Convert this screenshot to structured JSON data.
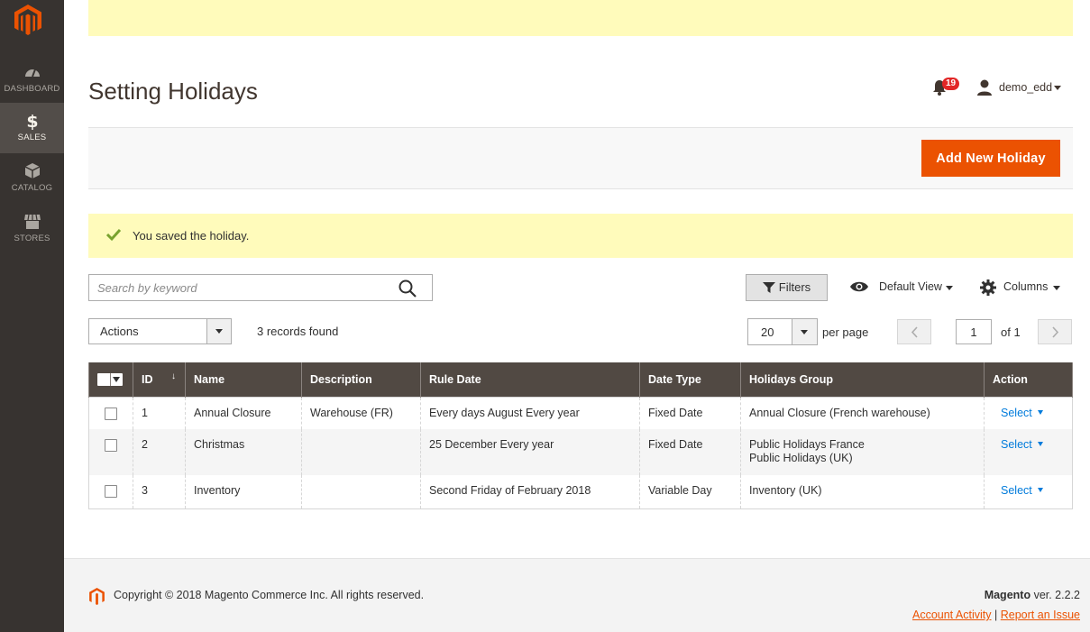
{
  "sidebar": {
    "items": [
      {
        "label": "DASHBOARD",
        "icon": "dashboard-icon",
        "active": false
      },
      {
        "label": "SALES",
        "icon": "dollar-icon",
        "active": true
      },
      {
        "label": "CATALOG",
        "icon": "box-icon",
        "active": false
      },
      {
        "label": "STORES",
        "icon": "store-icon",
        "active": false
      }
    ]
  },
  "header": {
    "title": "Setting Holidays",
    "notifications_count": "19",
    "user_name": "demo_edd"
  },
  "toolbar": {
    "add_button_label": "Add New Holiday"
  },
  "message": {
    "text": "You saved the holiday."
  },
  "grid_controls": {
    "search_placeholder": "Search by keyword",
    "filters_label": "Filters",
    "view_label": "Default View",
    "columns_label": "Columns",
    "actions_label": "Actions",
    "records_found": "3 records found",
    "per_page_value": "20",
    "per_page_label": "per page",
    "current_page": "1",
    "page_of": "of 1"
  },
  "grid": {
    "columns": [
      "ID",
      "Name",
      "Description",
      "Rule Date",
      "Date Type",
      "Holidays Group",
      "Action"
    ],
    "rows": [
      {
        "id": "1",
        "name": "Annual Closure",
        "description": "Warehouse (FR)",
        "rule_date": "Every days August Every year",
        "date_type": "Fixed Date",
        "group_1": "Annual Closure (French warehouse)",
        "group_2": "",
        "action": "Select"
      },
      {
        "id": "2",
        "name": "Christmas",
        "description": "",
        "rule_date": "25 December Every year",
        "date_type": "Fixed Date",
        "group_1": "Public Holidays France",
        "group_2": "Public Holidays (UK)",
        "action": "Select"
      },
      {
        "id": "3",
        "name": "Inventory",
        "description": "",
        "rule_date": "Second Friday of February 2018",
        "date_type": "Variable Day",
        "group_1": "Inventory (UK)",
        "group_2": "",
        "action": "Select"
      }
    ]
  },
  "footer": {
    "copyright": "Copyright © 2018 Magento Commerce Inc. All rights reserved.",
    "brand": "Magento",
    "version": "ver. 2.2.2",
    "link_activity": "Account Activity",
    "separator": "|",
    "link_issue": "Report an Issue"
  },
  "colors": {
    "sidebar_bg": "#373330",
    "accent": "#eb5202",
    "grid_header": "#514943",
    "notice_bg": "#fffbbb",
    "link": "#007bdb"
  }
}
